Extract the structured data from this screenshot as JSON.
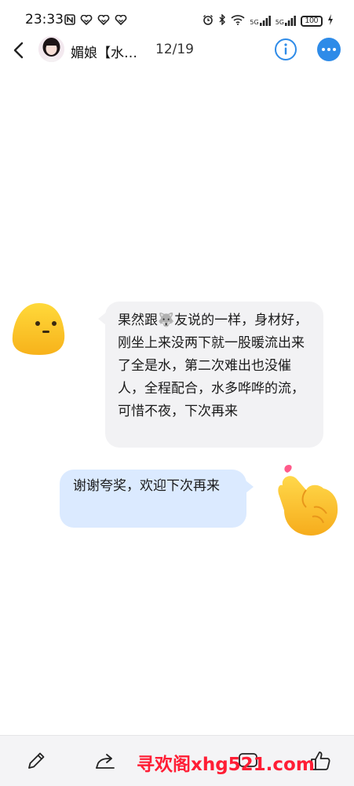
{
  "status_bar": {
    "time": "23:33",
    "network_label_1": "5G",
    "network_label_2": "5G",
    "battery": "100"
  },
  "header": {
    "contact_name": "媚娘【水…",
    "page_counter": "12/19"
  },
  "messages": [
    {
      "side": "incoming",
      "text": "果然跟🐺友说的一样，身材好，刚坐上来没两下就一股暖流出来了全是水，第二次难出也没催人，全程配合，水多哗哗的流，可惜不夜，下次再来"
    },
    {
      "side": "outgoing",
      "text": "谢谢夸奖，欢迎下次再来"
    }
  ],
  "icons": {
    "back": "chevron-left-icon",
    "info": "info-icon",
    "more": "more-horizontal-icon",
    "edit": "pencil-icon",
    "share": "share-icon",
    "like": "thumbs-up-icon"
  },
  "colors": {
    "accent": "#2e8be8",
    "incoming_bubble": "#f2f2f4",
    "outgoing_bubble": "#dbeaff",
    "watermark": "#ff1e35"
  },
  "watermark": {
    "text": "寻欢阁xhg521.com"
  }
}
